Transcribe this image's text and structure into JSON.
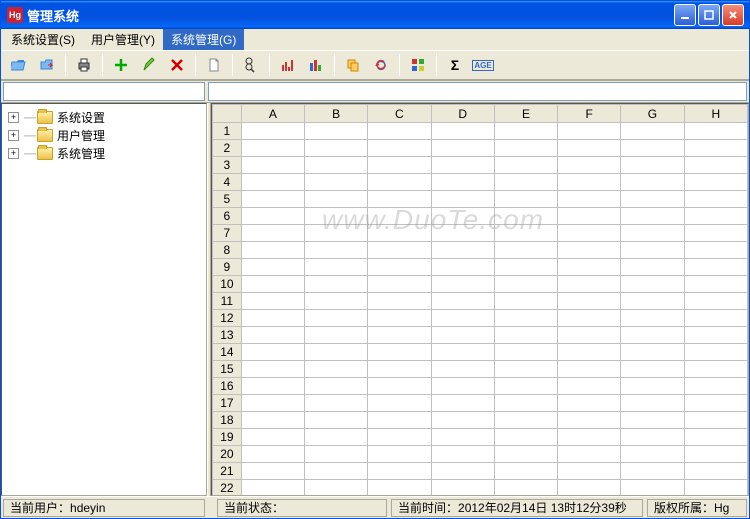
{
  "title": "管理系统",
  "menubar": [
    {
      "label": "系统设置(S)",
      "active": false
    },
    {
      "label": "用户管理(Y)",
      "active": false
    },
    {
      "label": "系统管理(G)",
      "active": true
    }
  ],
  "toolbar_icons": [
    "open-folder-icon",
    "folder-export-icon",
    "sep",
    "print-icon",
    "sep",
    "add-icon",
    "edit-icon",
    "delete-icon",
    "sep",
    "new-doc-icon",
    "sep",
    "find-icon",
    "sep",
    "chart-bar-icon",
    "chart-cols-icon",
    "sep",
    "copy-icon",
    "refresh-icon",
    "sep",
    "color-grid-icon",
    "sep",
    "sum-icon",
    "age-icon"
  ],
  "inputbar": {
    "address": "",
    "formula": ""
  },
  "tree": [
    {
      "label": "系统设置"
    },
    {
      "label": "用户管理"
    },
    {
      "label": "系统管理"
    }
  ],
  "grid": {
    "columns": [
      "A",
      "B",
      "C",
      "D",
      "E",
      "F",
      "G",
      "H"
    ],
    "row_count": 23
  },
  "status": {
    "user_label": "当前用户：",
    "user_value": "hdeyin",
    "state_label": "当前状态：",
    "state_value": "",
    "time_label": "当前时间：",
    "time_value": "2012年02月14日 13时12分39秒",
    "owner_label": "版权所属：",
    "owner_value": "Hg"
  },
  "watermark": "www.DuoTe.com"
}
